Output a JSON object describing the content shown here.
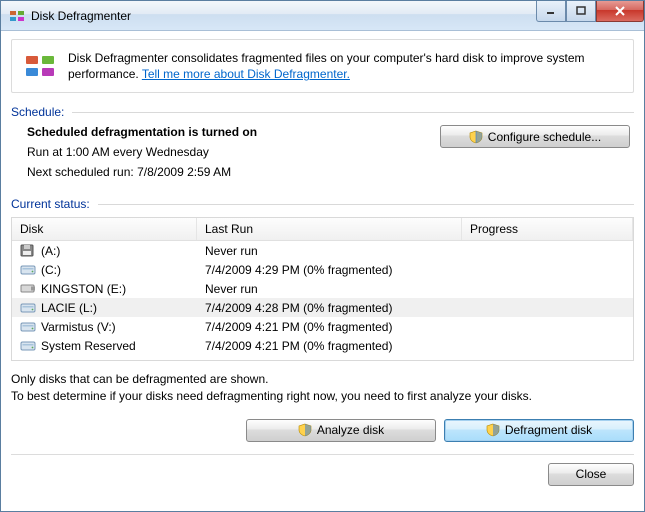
{
  "window": {
    "title": "Disk Defragmenter"
  },
  "info": {
    "text": "Disk Defragmenter consolidates fragmented files on your computer's hard disk to improve system performance. ",
    "link": "Tell me more about Disk Defragmenter."
  },
  "schedule": {
    "label": "Schedule:",
    "status": "Scheduled defragmentation is turned on",
    "run_at": "Run at 1:00 AM every Wednesday",
    "next_run": "Next scheduled run: 7/8/2009 2:59 AM",
    "configure_button": "Configure schedule..."
  },
  "status": {
    "label": "Current status:",
    "columns": {
      "disk": "Disk",
      "lastrun": "Last Run",
      "progress": "Progress"
    },
    "disks": [
      {
        "icon": "floppy",
        "name": "(A:)",
        "lastrun": "Never run",
        "progress": "",
        "selected": false
      },
      {
        "icon": "hdd",
        "name": "(C:)",
        "lastrun": "7/4/2009 4:29 PM (0% fragmented)",
        "progress": "",
        "selected": false
      },
      {
        "icon": "usb",
        "name": "KINGSTON (E:)",
        "lastrun": "Never run",
        "progress": "",
        "selected": false
      },
      {
        "icon": "hdd",
        "name": "LACIE (L:)",
        "lastrun": "7/4/2009 4:28 PM (0% fragmented)",
        "progress": "",
        "selected": true
      },
      {
        "icon": "hdd",
        "name": "Varmistus (V:)",
        "lastrun": "7/4/2009 4:21 PM (0% fragmented)",
        "progress": "",
        "selected": false
      },
      {
        "icon": "hdd",
        "name": "System Reserved",
        "lastrun": "7/4/2009 4:21 PM (0% fragmented)",
        "progress": "",
        "selected": false
      }
    ],
    "note1": "Only disks that can be defragmented are shown.",
    "note2": "To best determine if your disks need defragmenting right now, you need to first analyze your disks."
  },
  "actions": {
    "analyze": "Analyze disk",
    "defragment": "Defragment disk",
    "close": "Close"
  }
}
